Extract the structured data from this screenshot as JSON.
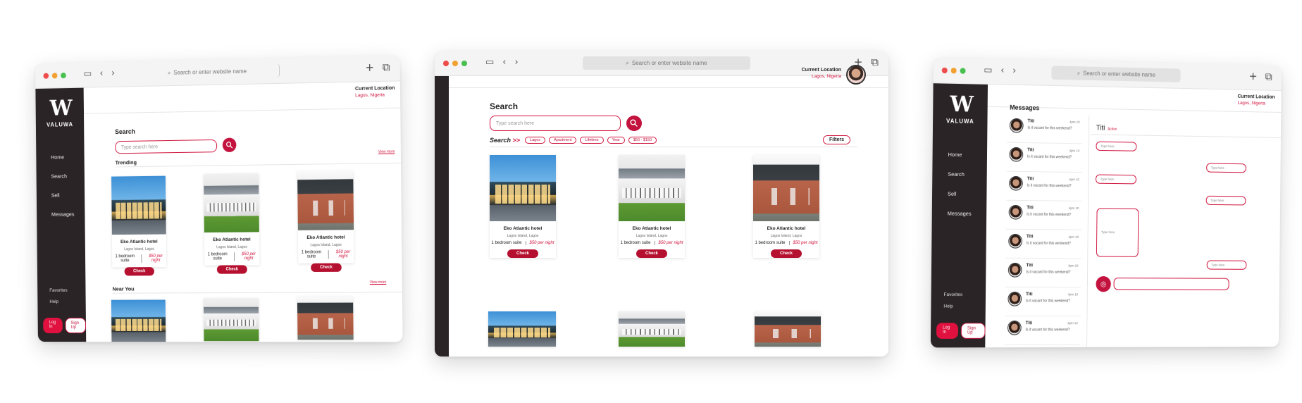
{
  "browser": {
    "url_placeholder": "Search or enter website name"
  },
  "brand": {
    "name": "VALUWA",
    "mark": "W"
  },
  "sidebar": {
    "items": [
      {
        "label": "Home"
      },
      {
        "label": "Search"
      },
      {
        "label": "Sell"
      },
      {
        "label": "Messages"
      }
    ],
    "bottom": [
      {
        "label": "Favorites"
      },
      {
        "label": "Help"
      }
    ],
    "login": "Log In",
    "signup": "Sign Up"
  },
  "location": {
    "title": "Current Location",
    "value": "Lagos, Nigeria"
  },
  "search_page": {
    "title": "Search",
    "placeholder": "Type search here",
    "trending": "Trending",
    "near_you": "Near You",
    "view_more": "View more"
  },
  "filters": {
    "label": "Search",
    "arrows": ">>",
    "chips": [
      "Lagos",
      "Apartment",
      "Lifetime",
      "Year",
      "$50 - $150"
    ],
    "button": "Filters"
  },
  "listing": {
    "name": "Eko Atlantic hotel",
    "address": "Lagos Island, Lagos",
    "rooms": "1 bedroom suite",
    "price": "$50 per night",
    "check": "Check"
  },
  "messages": {
    "title": "Messages",
    "contact": "Titi",
    "status": "Active",
    "preview": "Is it vacant for this weekend?",
    "time": "4pm 10",
    "bubble_placeholder": "Type here",
    "count": 8
  }
}
